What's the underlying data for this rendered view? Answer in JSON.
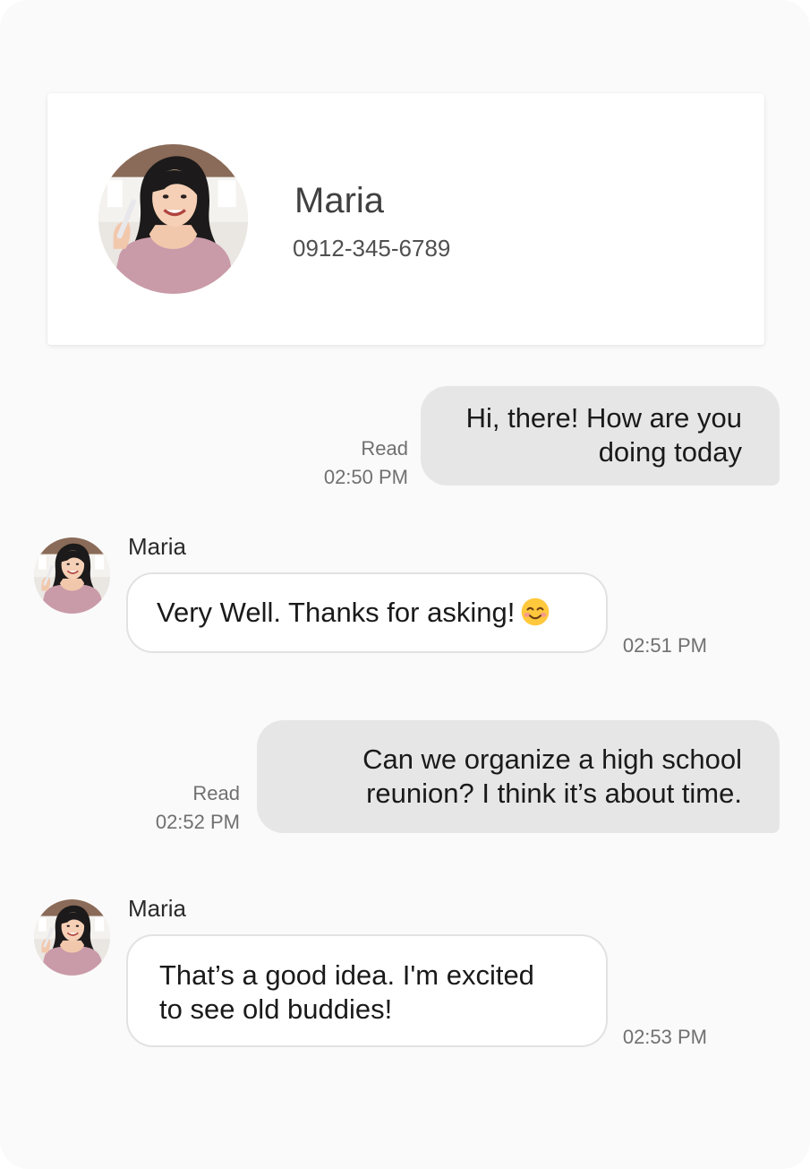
{
  "contact": {
    "name": "Maria",
    "phone": "0912-345-6789",
    "avatar_icon": "person-photo"
  },
  "messages": [
    {
      "direction": "sent",
      "lines": [
        "Hi, there! How are you",
        "doing today"
      ],
      "status": "Read",
      "time": "02:50 PM"
    },
    {
      "direction": "received",
      "sender": "Maria",
      "text": "Very Well. Thanks for asking!",
      "emoji": "smiling-face-icon",
      "time": "02:51 PM"
    },
    {
      "direction": "sent",
      "lines": [
        "Can we organize a high school",
        "reunion? I think it’s about time."
      ],
      "status": "Read",
      "time": "02:52 PM"
    },
    {
      "direction": "received",
      "sender": "Maria",
      "lines": [
        "That’s a good idea. I'm excited",
        "to see old buddies!"
      ],
      "time": "02:53 PM"
    }
  ],
  "colors": {
    "background": "#fafafa",
    "sent_bubble": "#e6e6e6",
    "received_bubble": "#ffffff",
    "meta_text": "#707070"
  }
}
